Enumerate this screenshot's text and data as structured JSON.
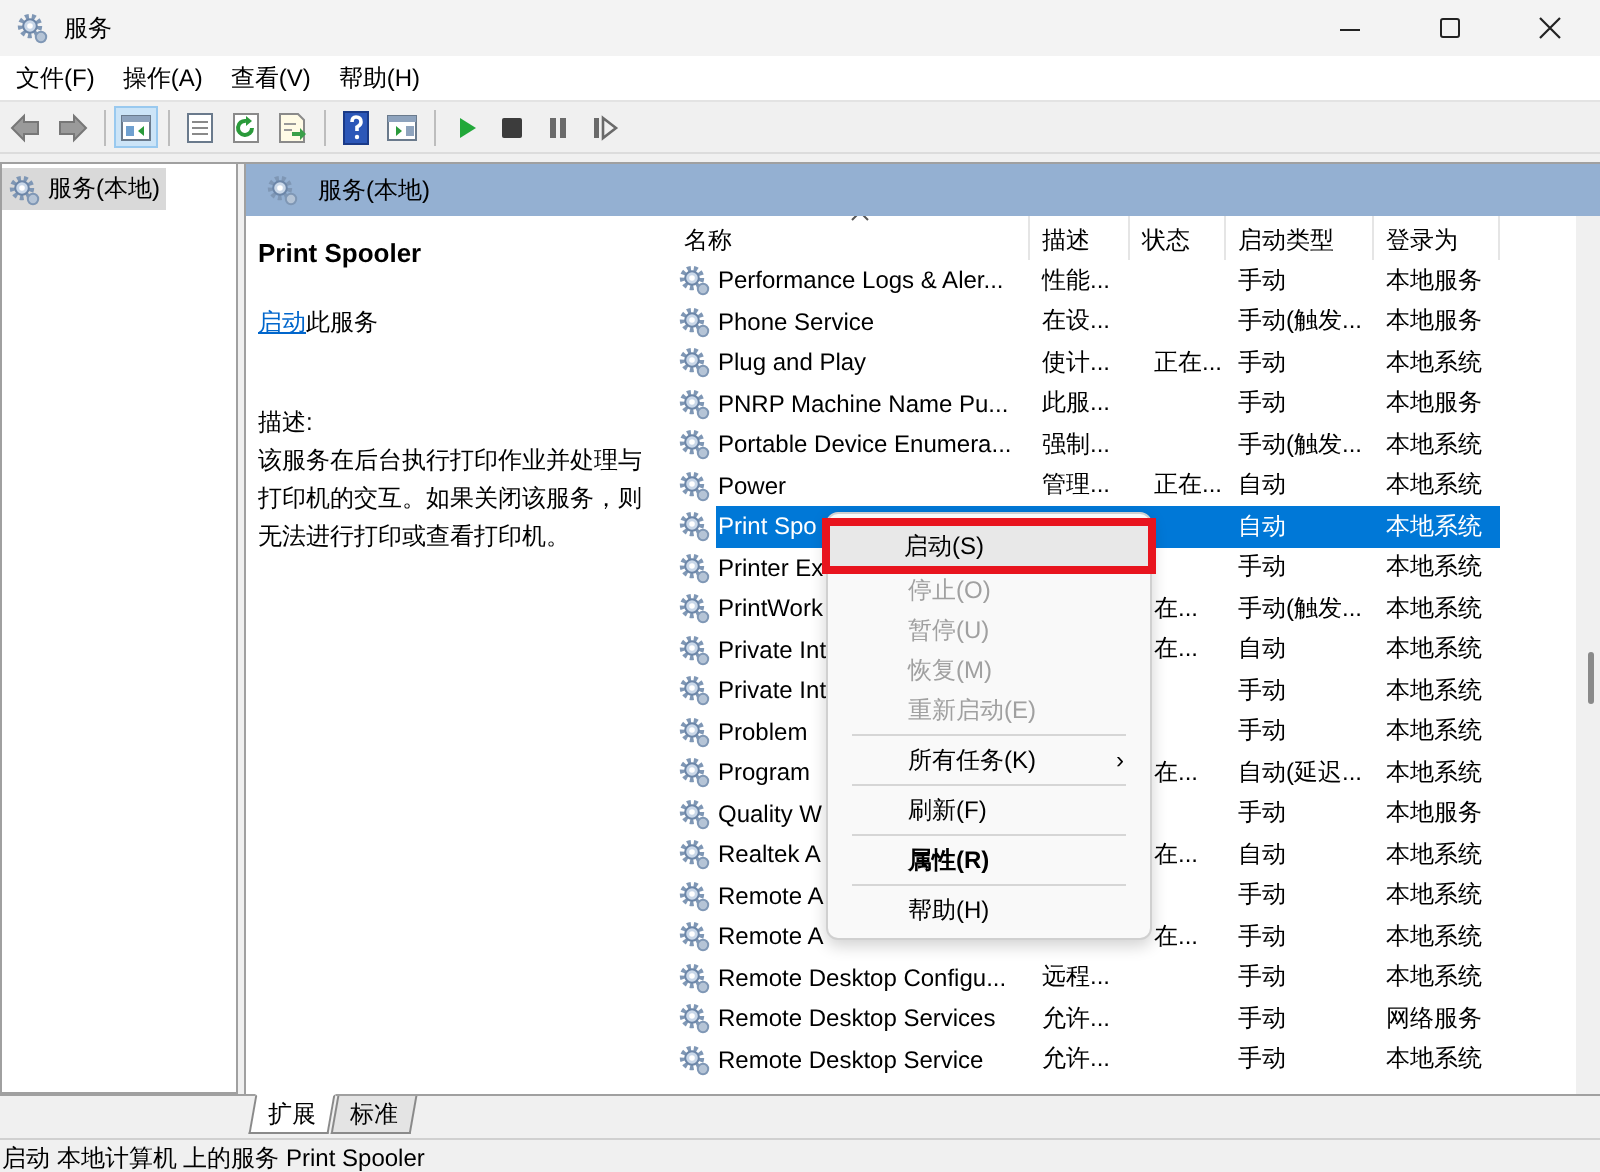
{
  "window": {
    "title": "服务",
    "controls": [
      {
        "kind": "minimize"
      },
      {
        "kind": "maximize"
      },
      {
        "kind": "close"
      }
    ]
  },
  "menu_bar": [
    "文件(F)",
    "操作(A)",
    "查看(V)",
    "帮助(H)"
  ],
  "toolbar": [
    {
      "kind": "back",
      "pressed": false
    },
    {
      "kind": "forward",
      "pressed": false
    },
    {
      "kind": "sep"
    },
    {
      "kind": "tree",
      "pressed": true
    },
    {
      "kind": "sep"
    },
    {
      "kind": "properties",
      "pressed": false
    },
    {
      "kind": "refresh",
      "pressed": false
    },
    {
      "kind": "export",
      "pressed": false
    },
    {
      "kind": "sep"
    },
    {
      "kind": "help",
      "pressed": false
    },
    {
      "kind": "pane",
      "pressed": false
    },
    {
      "kind": "sep"
    },
    {
      "kind": "play",
      "pressed": false
    },
    {
      "kind": "stop",
      "pressed": false
    },
    {
      "kind": "pause",
      "pressed": false
    },
    {
      "kind": "resume",
      "pressed": false
    }
  ],
  "tree": {
    "items": [
      {
        "label": "服务(本地)",
        "selected": true
      }
    ]
  },
  "pane_header": "服务(本地)",
  "details": {
    "title": "Print Spooler",
    "action_link": "启动",
    "action_text": "此服务",
    "description_label": "描述:",
    "description": "该服务在后台执行打印作业并处理与打印机的交互。如果关闭该服务，则无法进行打印或查看打印机。"
  },
  "table": {
    "columns": [
      {
        "label": "名称",
        "sorted": true
      },
      {
        "label": "描述",
        "sorted": false
      },
      {
        "label": "状态",
        "sorted": false
      },
      {
        "label": "启动类型",
        "sorted": false
      },
      {
        "label": "登录为",
        "sorted": false
      }
    ],
    "rows": [
      {
        "name": "Performance Logs & Aler...",
        "description": "性能...",
        "startup": "手动",
        "logon": "本地服务",
        "selected": false
      },
      {
        "name": "Phone Service",
        "description": "在设...",
        "startup": "手动(触发...",
        "logon": "本地服务",
        "selected": false
      },
      {
        "name": "Plug and Play",
        "description": "使计...",
        "status": "正在...",
        "startup": "手动",
        "logon": "本地系统",
        "selected": false
      },
      {
        "name": "PNRP Machine Name Pu...",
        "description": "此服...",
        "startup": "手动",
        "logon": "本地服务",
        "selected": false
      },
      {
        "name": "Portable Device Enumera...",
        "description": "强制...",
        "startup": "手动(触发...",
        "logon": "本地系统",
        "selected": false
      },
      {
        "name": "Power",
        "description": "管理...",
        "status": "正在...",
        "startup": "自动",
        "logon": "本地系统",
        "selected": false
      },
      {
        "name": "Print Spo",
        "startup": "自动",
        "logon": "本地系统",
        "selected": true
      },
      {
        "name": "Printer Ex",
        "startup": "手动",
        "logon": "本地系统",
        "selected": false
      },
      {
        "name": "PrintWork",
        "status": "在...",
        "startup": "手动(触发...",
        "logon": "本地系统",
        "selected": false
      },
      {
        "name": "Private Int",
        "status": "在...",
        "startup": "自动",
        "logon": "本地系统",
        "selected": false
      },
      {
        "name": "Private Int",
        "startup": "手动",
        "logon": "本地系统",
        "selected": false
      },
      {
        "name": "Problem",
        "startup": "手动",
        "logon": "本地系统",
        "selected": false
      },
      {
        "name": "Program",
        "status": "在...",
        "startup": "自动(延迟...",
        "logon": "本地系统",
        "selected": false
      },
      {
        "name": "Quality W",
        "startup": "手动",
        "logon": "本地服务",
        "selected": false
      },
      {
        "name": "Realtek A",
        "status": "在...",
        "startup": "自动",
        "logon": "本地系统",
        "selected": false
      },
      {
        "name": "Remote A",
        "startup": "手动",
        "logon": "本地系统",
        "selected": false
      },
      {
        "name": "Remote A",
        "status": "在...",
        "startup": "手动",
        "logon": "本地系统",
        "selected": false
      },
      {
        "name": "Remote Desktop Configu...",
        "description": "远程...",
        "startup": "手动",
        "logon": "本地系统",
        "selected": false
      },
      {
        "name": "Remote Desktop Services",
        "description": "允许...",
        "startup": "手动",
        "logon": "网络服务",
        "selected": false
      },
      {
        "name": "Remote Desktop Service",
        "description": "允许...",
        "startup": "手动",
        "logon": "本地系统",
        "selected": false
      }
    ]
  },
  "context_menu": [
    {
      "kind": "command",
      "label": "启动(S)",
      "disabled": false,
      "selected": true,
      "outlined": true,
      "default": false
    },
    {
      "kind": "command",
      "label": "停止(O)",
      "disabled": true,
      "selected": false,
      "outlined": false,
      "default": false
    },
    {
      "kind": "command",
      "label": "暂停(U)",
      "disabled": true,
      "selected": false,
      "outlined": false,
      "default": false
    },
    {
      "kind": "command",
      "label": "恢复(M)",
      "disabled": true,
      "selected": false,
      "outlined": false,
      "default": false
    },
    {
      "kind": "command",
      "label": "重新启动(E)",
      "disabled": true,
      "selected": false,
      "outlined": false,
      "default": false
    },
    {
      "kind": "separator"
    },
    {
      "kind": "submenu",
      "label": "所有任务(K)",
      "arrow": "›",
      "disabled": false,
      "selected": false,
      "outlined": false,
      "default": false
    },
    {
      "kind": "separator"
    },
    {
      "kind": "command",
      "label": "刷新(F)",
      "disabled": false,
      "selected": false,
      "outlined": false,
      "default": false
    },
    {
      "kind": "separator"
    },
    {
      "kind": "command",
      "label": "属性(R)",
      "disabled": false,
      "selected": false,
      "outlined": false,
      "default": true
    },
    {
      "kind": "separator"
    },
    {
      "kind": "command",
      "label": "帮助(H)",
      "disabled": false,
      "selected": false,
      "outlined": false,
      "default": false
    }
  ],
  "view_tabs": [
    {
      "label": "扩展",
      "selected": true
    },
    {
      "label": "标准",
      "selected": false
    }
  ],
  "status_bar": "启动 本地计算机 上的服务 Print Spooler"
}
